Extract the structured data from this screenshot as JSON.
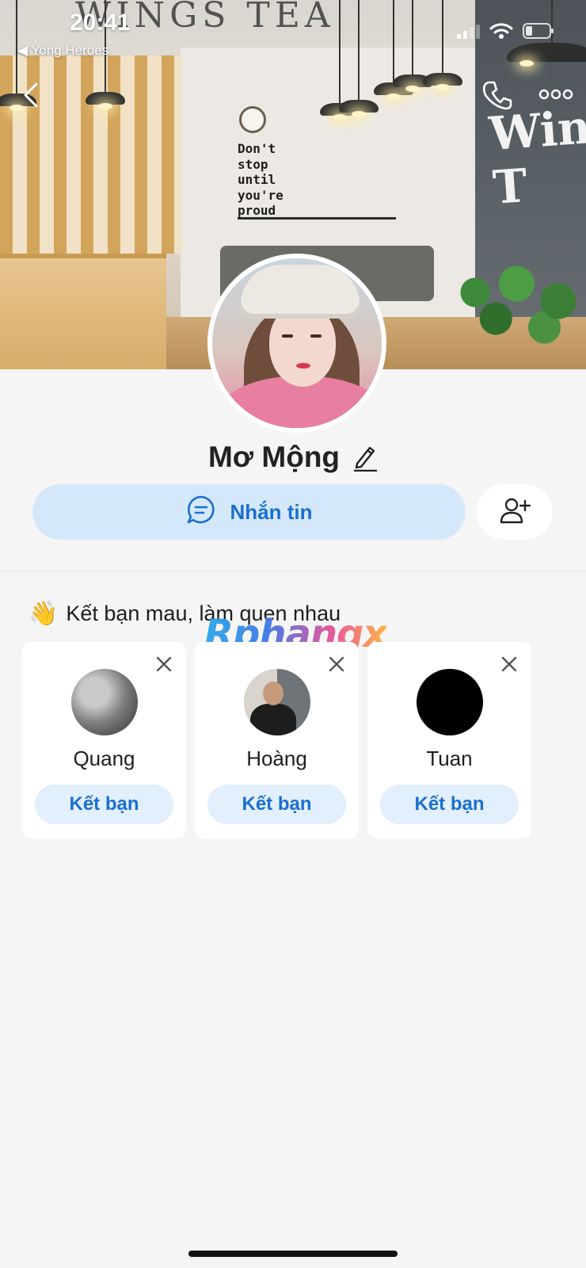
{
  "status_bar": {
    "time": "20:41",
    "back_app": "◀ Yong Heroes"
  },
  "cover": {
    "sign_top": "WINGS TEA",
    "sign_right": "Wings T",
    "quote": "Don't\nstop\nuntil\nyou're\nproud"
  },
  "header": {
    "back_icon": "chevron-left-icon",
    "call_icon": "phone-icon",
    "more_icon": "more-dots-icon"
  },
  "profile": {
    "name": "Mơ Mộng",
    "edit_icon": "pencil-icon"
  },
  "actions": {
    "message_label": "Nhắn tin",
    "add_friend_icon": "add-user-icon"
  },
  "suggestions": {
    "emoji": "👋",
    "title": "Kết bạn mau, làm quen nhau",
    "watermark": "Rphangx",
    "cards": [
      {
        "name": "Quang",
        "button": "Kết bạn"
      },
      {
        "name": "Hoàng",
        "button": "Kết bạn"
      },
      {
        "name": "Tuan",
        "button": "Kết bạn"
      }
    ]
  },
  "colors": {
    "accent": "#1a6fd0",
    "message_button_bg": "#d5e8fb",
    "friend_button_bg": "#e2effc",
    "page_bg": "#f5f5f5"
  }
}
